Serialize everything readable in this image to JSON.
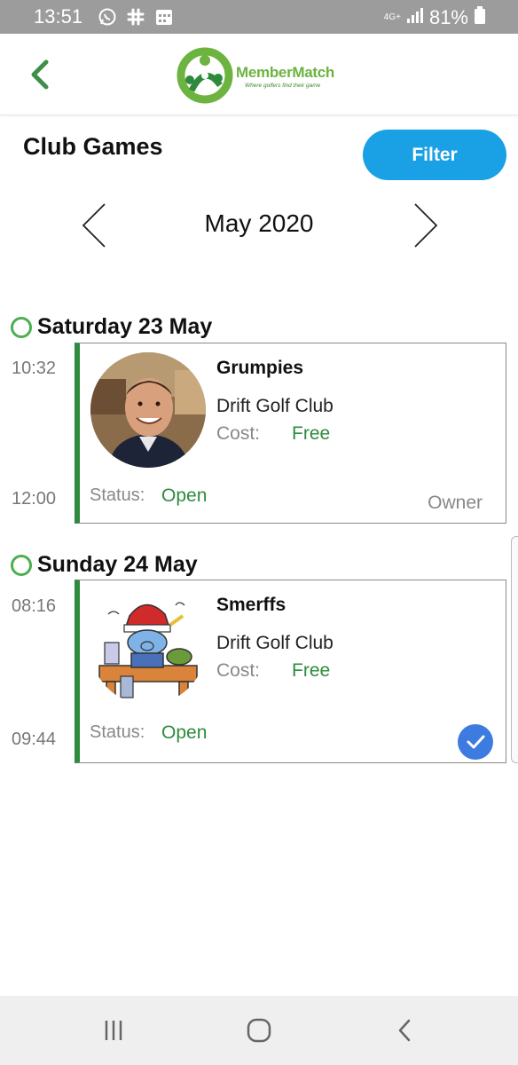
{
  "status_bar": {
    "time": "13:51",
    "network": "4G+",
    "battery": "81%",
    "icons": [
      "whatsapp-icon",
      "slack-icon",
      "calendar-icon",
      "signal-icon",
      "battery-icon"
    ]
  },
  "header": {
    "back_icon": "chevron-left-icon",
    "logo_name": "MemberMatch",
    "logo_tagline": "Where golfers find their game",
    "accent_color": "#6db33f"
  },
  "page": {
    "title": "Club Games",
    "filter_label": "Filter",
    "filter_color": "#1aa0e4"
  },
  "month_nav": {
    "label": "May 2020",
    "prev_icon": "chevron-left-icon",
    "next_icon": "chevron-right-icon"
  },
  "days": [
    {
      "label": "Saturday 23 May",
      "games": [
        {
          "start": "10:32",
          "end": "12:00",
          "name": "Grumpies",
          "club": "Drift Golf Club",
          "cost_label": "Cost:",
          "cost": "Free",
          "status_label": "Status:",
          "status": "Open",
          "role": "Owner",
          "avatar": "person-photo"
        }
      ]
    },
    {
      "label": "Sunday 24 May",
      "games": [
        {
          "start": "08:16",
          "end": "09:44",
          "name": "Smerffs",
          "club": "Drift Golf Club",
          "cost_label": "Cost:",
          "cost": "Free",
          "status_label": "Status:",
          "status": "Open",
          "joined_icon": "check-icon",
          "avatar": "cartoon-image"
        }
      ]
    }
  ],
  "colors": {
    "green": "#2e8b3e",
    "check_blue": "#3d7be0"
  },
  "nav_bar": {
    "recents_icon": "recents-icon",
    "home_icon": "home-icon",
    "back_icon": "back-icon"
  }
}
